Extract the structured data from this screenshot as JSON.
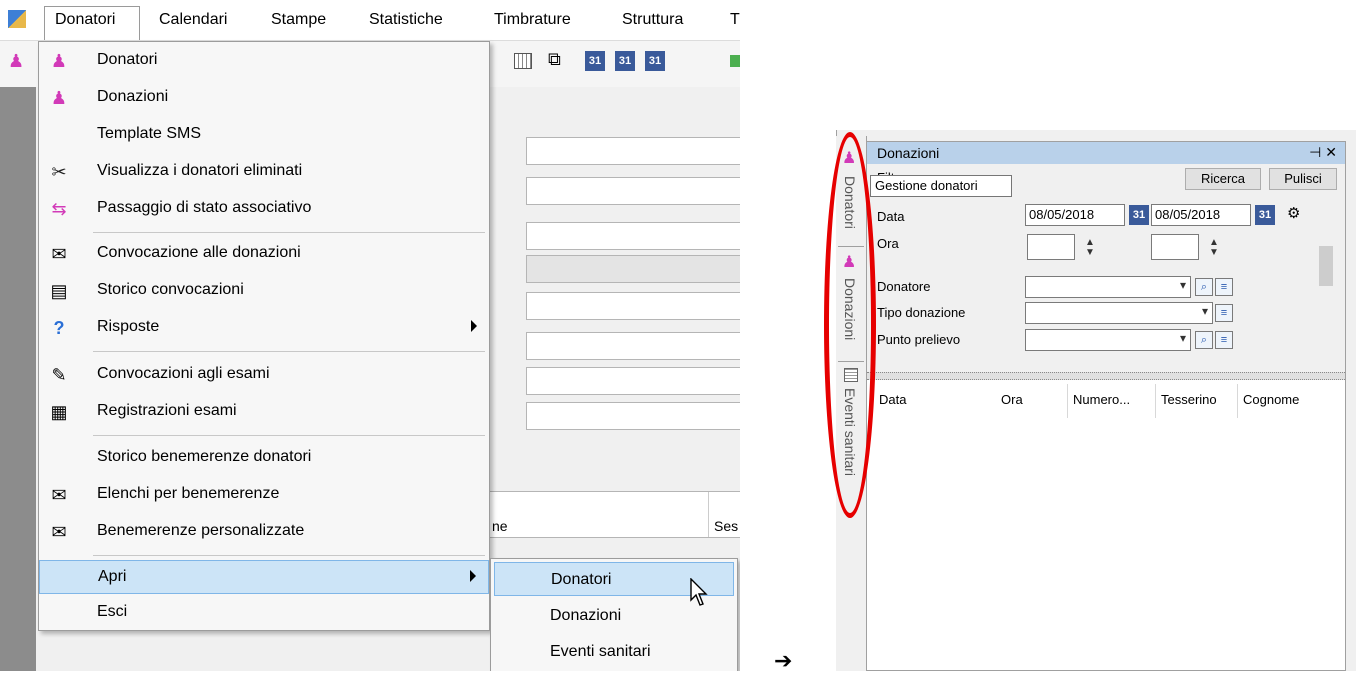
{
  "menubar": {
    "items": [
      "Donatori",
      "Calendari",
      "Stampe",
      "Statistiche",
      "Timbrature",
      "Struttura",
      "T"
    ]
  },
  "donatori_menu": {
    "items": [
      {
        "label": "Donatori",
        "icon": "donor-icon"
      },
      {
        "label": "Donazioni",
        "icon": "donation-icon"
      },
      {
        "label": "Template SMS",
        "icon": ""
      },
      {
        "label": "Visualizza i donatori eliminati",
        "icon": "deleted-donors-icon"
      },
      {
        "label": "Passaggio di stato associativo",
        "icon": "state-change-icon"
      },
      {
        "label": "Convocazione alle donazioni",
        "icon": "convocation-icon"
      },
      {
        "label": "Storico convocazioni",
        "icon": "history-icon"
      },
      {
        "label": "Risposte",
        "icon": "question-icon"
      },
      {
        "label": "Convocazioni agli esami",
        "icon": "exam-convocation-icon"
      },
      {
        "label": "Registrazioni esami",
        "icon": "exam-registration-icon"
      },
      {
        "label": "Storico benemerenze donatori",
        "icon": ""
      },
      {
        "label": "Elenchi per benemerenze",
        "icon": "award-list-icon"
      },
      {
        "label": "Benemerenze personalizzate",
        "icon": "custom-award-icon"
      },
      {
        "label": "Apri",
        "icon": ""
      },
      {
        "label": "Esci",
        "icon": ""
      }
    ]
  },
  "apri_submenu": {
    "items": [
      "Donatori",
      "Donazioni",
      "Eventi sanitari"
    ]
  },
  "background": {
    "col_partial_1": "ne",
    "col_partial_2": "Ses"
  },
  "arrow_symbol": "➔",
  "right": {
    "vertical_tabs": [
      "Donatori",
      "Donazioni",
      "Eventi sanitari"
    ],
    "tooltip": "Gestione donatori",
    "window": {
      "title": "Donazioni",
      "controls": "⊣ ✕",
      "filter_label_partial": "Filt",
      "ricerca_button": "Ricerca",
      "pulisci_button": "Pulisci",
      "fields": {
        "data_label": "Data",
        "data_from": "08/05/2018",
        "data_to": "08/05/2018",
        "ora_label": "Ora",
        "donatore_label": "Donatore",
        "tipo_label": "Tipo donazione",
        "punto_label": "Punto prelievo"
      },
      "grid_columns": [
        "Data",
        "Ora",
        "Numero...",
        "Tesserino",
        "Cognome"
      ]
    }
  },
  "colors": {
    "highlight": "#cce4f7",
    "highlight_border": "#7fb6e8",
    "title_bar": "#b9d1ea",
    "annotation_red": "#e60000"
  }
}
